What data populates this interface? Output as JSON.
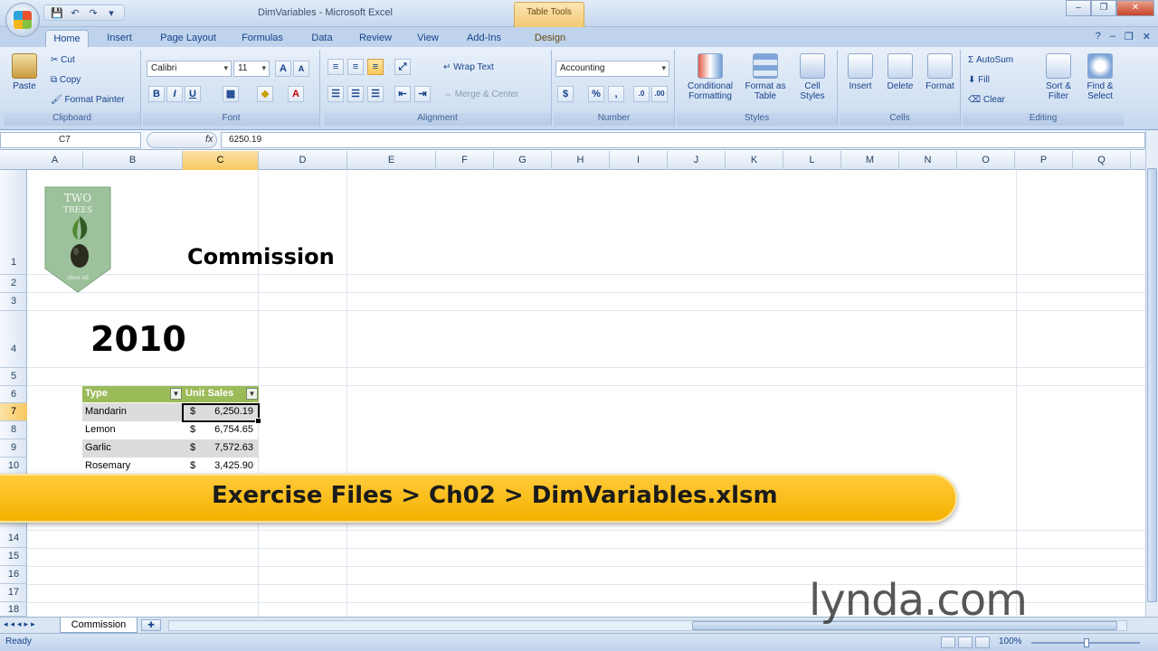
{
  "window": {
    "title": "DimVariables - Microsoft Excel",
    "context_tab": "Table Tools"
  },
  "quick_access": {
    "save": "💾",
    "undo": "↶",
    "redo": "↷"
  },
  "tabs": [
    "Home",
    "Insert",
    "Page Layout",
    "Formulas",
    "Data",
    "Review",
    "View",
    "Add-Ins",
    "Design"
  ],
  "ribbon": {
    "clipboard": {
      "paste": "Paste",
      "cut": "Cut",
      "copy": "Copy",
      "format_painter": "Format Painter",
      "label": "Clipboard"
    },
    "font": {
      "name": "Calibri",
      "size": "11",
      "grow": "A",
      "shrink": "A",
      "bold": "B",
      "italic": "I",
      "underline": "U",
      "label": "Font"
    },
    "alignment": {
      "wrap": "Wrap Text",
      "merge": "Merge & Center",
      "label": "Alignment"
    },
    "number": {
      "format": "Accounting",
      "currency": "$",
      "percent": "%",
      "comma": ",",
      "label": "Number"
    },
    "styles": {
      "conditional": "Conditional Formatting",
      "format_table": "Format as Table",
      "cell_styles": "Cell Styles",
      "label": "Styles"
    },
    "cells": {
      "insert": "Insert",
      "delete": "Delete",
      "format": "Format",
      "label": "Cells"
    },
    "editing": {
      "autosum": "AutoSum",
      "fill": "Fill",
      "clear": "Clear",
      "sort": "Sort & Filter",
      "find": "Find & Select",
      "label": "Editing"
    }
  },
  "formula_bar": {
    "name_box": "C7",
    "fx": "fx",
    "value": "6250.19"
  },
  "columns": [
    "A",
    "B",
    "C",
    "D",
    "E",
    "F",
    "G",
    "H",
    "I",
    "J",
    "K",
    "L",
    "M",
    "N",
    "O",
    "P",
    "Q"
  ],
  "rows": [
    "1",
    "2",
    "3",
    "4",
    "5",
    "6",
    "7",
    "8",
    "9",
    "10",
    "14",
    "15",
    "16",
    "17",
    "18"
  ],
  "logo": {
    "line1": "TWO",
    "line2": "TREES",
    "line3": "olive oil"
  },
  "sheet": {
    "heading": "Commission",
    "year": "2010",
    "table_headers": [
      "Type",
      "Unit Sales"
    ],
    "table_rows": [
      {
        "type": "Mandarin",
        "currency": "$",
        "value": "6,250.19"
      },
      {
        "type": "Lemon",
        "currency": "$",
        "value": "6,754.65"
      },
      {
        "type": "Garlic",
        "currency": "$",
        "value": "7,572.63"
      },
      {
        "type": "Rosemary",
        "currency": "$",
        "value": "3,425.90"
      }
    ]
  },
  "banner": "Exercise Files > Ch02 > DimVariables.xlsm",
  "sheet_tabs": [
    "Commission"
  ],
  "status": {
    "ready": "Ready",
    "zoom": "100%"
  },
  "watermark": "lynda.com"
}
